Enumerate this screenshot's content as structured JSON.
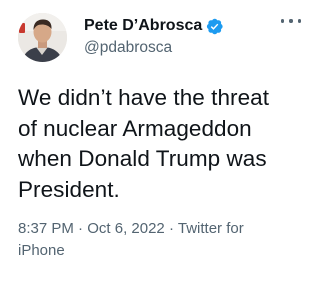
{
  "author": {
    "display_name": "Pete D’Abrosca",
    "handle": "@pdabrosca",
    "verified": true,
    "verified_color": "#1d9bf0"
  },
  "menu": {
    "icon": "more-icon"
  },
  "tweet": {
    "text_lines": [
      "We didn’t have the threat",
      "of nuclear Armageddon",
      "when Donald Trump was",
      "President."
    ]
  },
  "meta": {
    "time": "8:37 PM",
    "separator": "·",
    "date": "Oct 6, 2022",
    "source_line1": "Twitter for",
    "source_line2": "iPhone"
  },
  "colors": {
    "text": "#0f1419",
    "secondary": "#536471",
    "background": "#ffffff"
  }
}
